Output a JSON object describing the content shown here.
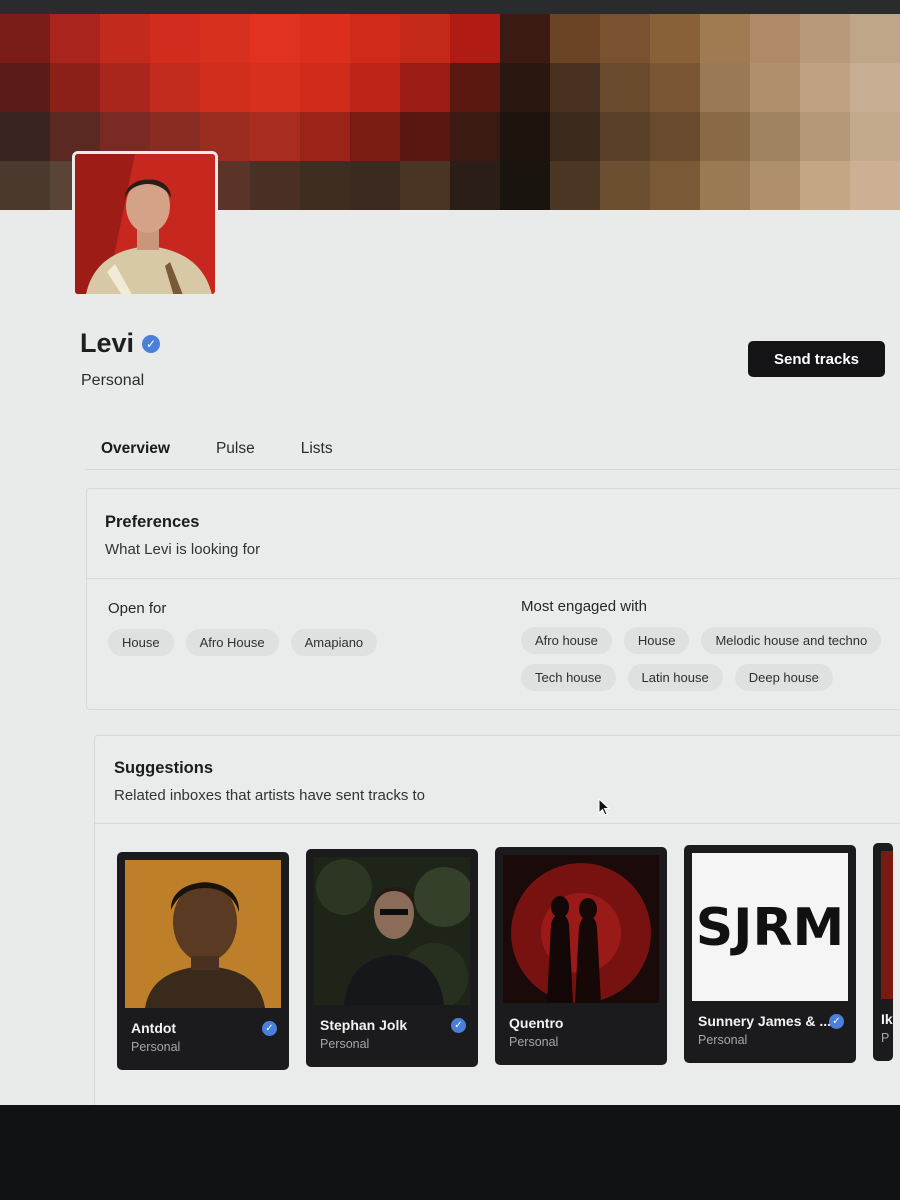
{
  "profile": {
    "name": "Levi",
    "role": "Personal",
    "send_button": "Send tracks"
  },
  "tabs": [
    {
      "label": "Overview",
      "active": true
    },
    {
      "label": "Pulse",
      "active": false
    },
    {
      "label": "Lists",
      "active": false
    }
  ],
  "preferences": {
    "title": "Preferences",
    "subtitle": "What Levi is looking for",
    "open_for_label": "Open for",
    "open_for": [
      "House",
      "Afro House",
      "Amapiano"
    ],
    "engaged_label": "Most engaged with",
    "engaged": [
      "Afro house",
      "House",
      "Melodic house and techno",
      "Tech house",
      "Latin house",
      "Deep house"
    ]
  },
  "suggestions": {
    "title": "Suggestions",
    "subtitle": "Related inboxes that artists have sent tracks to",
    "items": [
      {
        "name": "Antdot",
        "role": "Personal",
        "verified": true
      },
      {
        "name": "Stephan Jolk",
        "role": "Personal",
        "verified": true
      },
      {
        "name": "Quentro",
        "role": "Personal",
        "verified": false
      },
      {
        "name": "Sunnery James & ...",
        "role": "Personal",
        "verified": true,
        "logo_text": "SJRM"
      },
      {
        "name": "Ik",
        "role": "P",
        "verified": false
      }
    ]
  },
  "colors": {
    "accent_verified": "#4a7fdc",
    "button_bg": "#141416",
    "page_bg": "#e9eaea"
  },
  "icons": [
    "verified-check-icon",
    "mouse-cursor-icon"
  ]
}
